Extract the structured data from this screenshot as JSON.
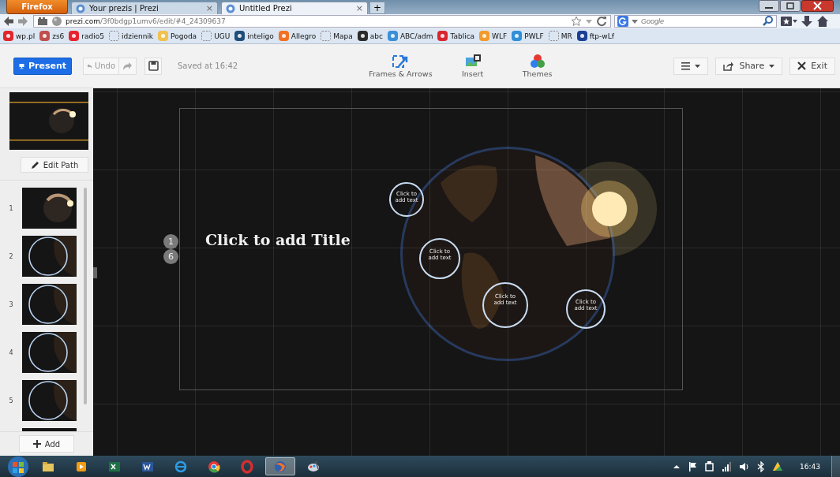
{
  "browser": {
    "menu_button": "Firefox",
    "tabs": [
      {
        "title": "Your prezis | Prezi",
        "close": "×",
        "selected": false
      },
      {
        "title": "Untitled Prezi",
        "close": "×",
        "selected": true
      }
    ],
    "new_tab": "+",
    "url": {
      "domain": "prezi.com",
      "path": "/3f0bdgp1umv6/edit/#4_24309637"
    },
    "search": {
      "placeholder": "Google"
    },
    "bookmarks": [
      {
        "label": "wp.pl",
        "kind": "favicon",
        "color": "#e0262c"
      },
      {
        "label": "zs6",
        "kind": "favicon",
        "color": "#c0504d"
      },
      {
        "label": "radio5",
        "kind": "favicon",
        "color": "#e8232d"
      },
      {
        "label": "idziennik",
        "kind": "blank"
      },
      {
        "label": "Pogoda",
        "kind": "favicon",
        "color": "#f2c14e"
      },
      {
        "label": "UGU",
        "kind": "blank"
      },
      {
        "label": "inteligo",
        "kind": "favicon",
        "color": "#1f4e79"
      },
      {
        "label": "Allegro",
        "kind": "favicon",
        "color": "#f36f21"
      },
      {
        "label": "Mapa",
        "kind": "blank"
      },
      {
        "label": "abc",
        "kind": "favicon",
        "color": "#2b2b2b"
      },
      {
        "label": "ABC/adm",
        "kind": "favicon",
        "color": "#3a8fd8"
      },
      {
        "label": "Tablica",
        "kind": "favicon",
        "color": "#d9262e"
      },
      {
        "label": "WLF",
        "kind": "favicon",
        "color": "#f39a2b"
      },
      {
        "label": "PWLF",
        "kind": "favicon",
        "color": "#2f8fd8"
      },
      {
        "label": "MR",
        "kind": "blank"
      },
      {
        "label": "ftp-wLf",
        "kind": "favicon",
        "color": "#1c3f94"
      }
    ]
  },
  "toolbar": {
    "present": "Present",
    "undo": {
      "label": "Undo",
      "disabled": true
    },
    "saved": "Saved at 16:42",
    "tools": [
      {
        "label": "Frames & Arrows",
        "kind": "frames"
      },
      {
        "label": "Insert",
        "kind": "insert"
      },
      {
        "label": "Themes",
        "kind": "themes"
      }
    ],
    "share": "Share",
    "exit": "Exit"
  },
  "sidebar": {
    "edit_path": "Edit Path",
    "steps": [
      {
        "number": "1",
        "kind": "planet"
      },
      {
        "number": "2",
        "kind": "ring"
      },
      {
        "number": "3",
        "kind": "ring"
      },
      {
        "number": "4",
        "kind": "ring"
      },
      {
        "number": "5",
        "kind": "ring"
      }
    ],
    "add": "Add"
  },
  "canvas": {
    "title": "Click to add Title",
    "badges": [
      "1",
      "6"
    ],
    "frames": [
      {
        "kind": "circle",
        "text": "Click to add text"
      },
      {
        "kind": "circle",
        "text": "Click to add text"
      },
      {
        "kind": "circle",
        "text": "Click to add text"
      },
      {
        "kind": "circle",
        "text": "Click to add text"
      }
    ]
  },
  "taskbar": {
    "apps": [
      {
        "kind": "folder",
        "active": false
      },
      {
        "kind": "media",
        "active": false
      },
      {
        "kind": "excel",
        "active": false
      },
      {
        "kind": "word",
        "active": false
      },
      {
        "kind": "ie",
        "active": false
      },
      {
        "kind": "chrome",
        "active": false
      },
      {
        "kind": "opera",
        "active": false
      },
      {
        "kind": "firefox",
        "active": true
      },
      {
        "kind": "paint",
        "active": false
      }
    ],
    "clock": "16:43"
  }
}
